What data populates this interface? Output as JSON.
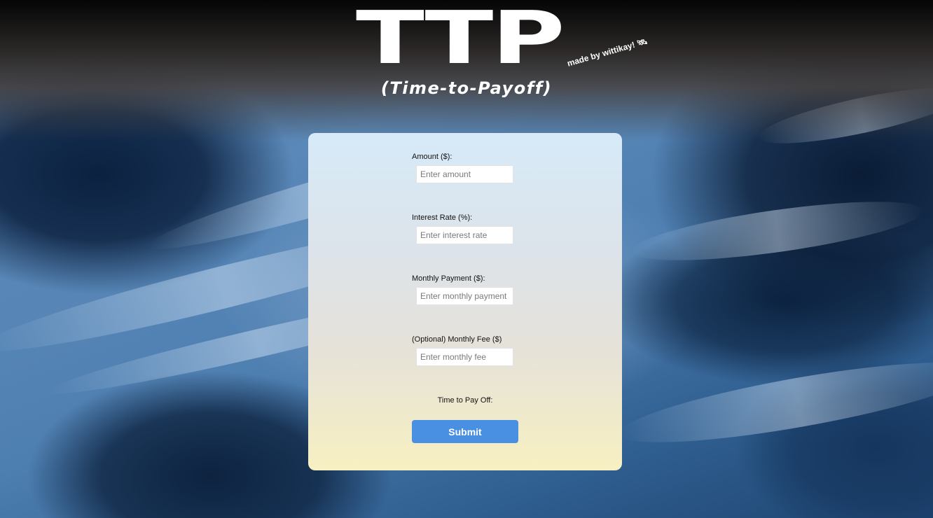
{
  "header": {
    "logo_text": "TTP",
    "made_by": "made by wittikay! 🛰",
    "subtitle": "(Time-to-Payoff)"
  },
  "form": {
    "amount": {
      "label": "Amount ($):",
      "placeholder": "Enter amount",
      "value": ""
    },
    "interest_rate": {
      "label": "Interest Rate (%):",
      "placeholder": "Enter interest rate",
      "value": ""
    },
    "monthly_payment": {
      "label": "Monthly Payment ($):",
      "placeholder": "Enter monthly payment",
      "value": ""
    },
    "monthly_fee": {
      "label": "(Optional) Monthly Fee ($)",
      "placeholder": "Enter monthly fee",
      "value": ""
    },
    "result_label": "Time to Pay Off:",
    "submit_label": "Submit"
  },
  "colors": {
    "submit_button": "#4a90e2",
    "card_top": "#d6eaf8",
    "card_bottom": "#f7f0c2"
  }
}
